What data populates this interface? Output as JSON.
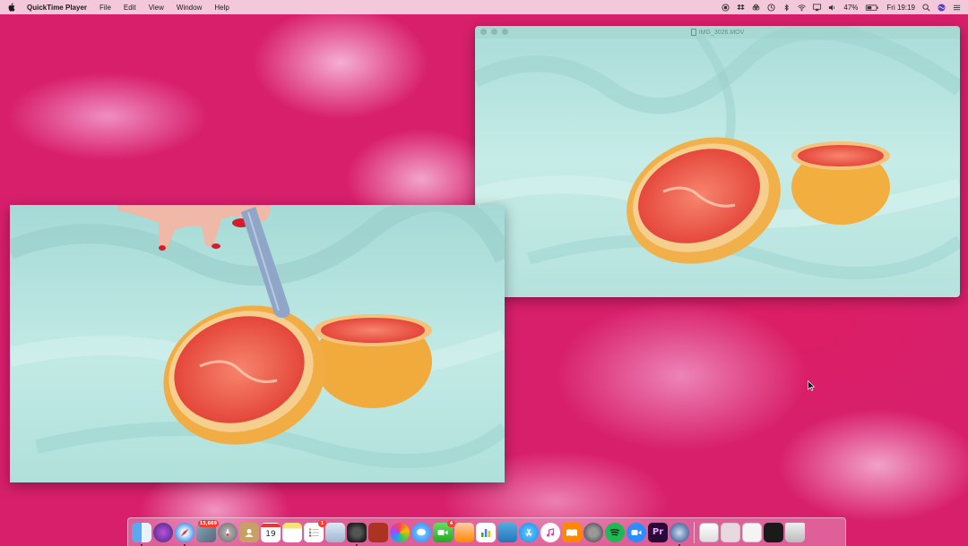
{
  "menubar": {
    "app_name": "QuickTime Player",
    "menus": [
      "File",
      "Edit",
      "View",
      "Window",
      "Help"
    ],
    "battery": "47%",
    "clock": "Fri 19:19"
  },
  "windows": {
    "right": {
      "title": "IMG_3026.MOV"
    },
    "left": {
      "title": ""
    }
  },
  "dock": {
    "calendar_day": "19",
    "badges": {
      "photos_app": "13,669",
      "reminders": "1",
      "messages": "4"
    },
    "apps": [
      "Finder",
      "Siri",
      "Safari",
      "Photos",
      "Launchpad",
      "Contacts",
      "Calendar",
      "Notes",
      "Reminders",
      "Preview",
      "Screenshot",
      "Photo Booth",
      "Photos",
      "Messages",
      "FaceTime",
      "Pages",
      "Numbers",
      "Keynote",
      "App Store",
      "iTunes",
      "iBooks",
      "System Preferences",
      "Spotify",
      "Zoom",
      "Premiere Pro",
      "QuickTime Player",
      "Document",
      "Window 1",
      "Window 2",
      "Window 3",
      "Trash"
    ]
  },
  "colors": {
    "wallpaper": "#d81f6b",
    "fabric": "#bfe8e4",
    "grapefruit_flesh": "#ef5a4a",
    "grapefruit_rind": "#f4b84a"
  }
}
